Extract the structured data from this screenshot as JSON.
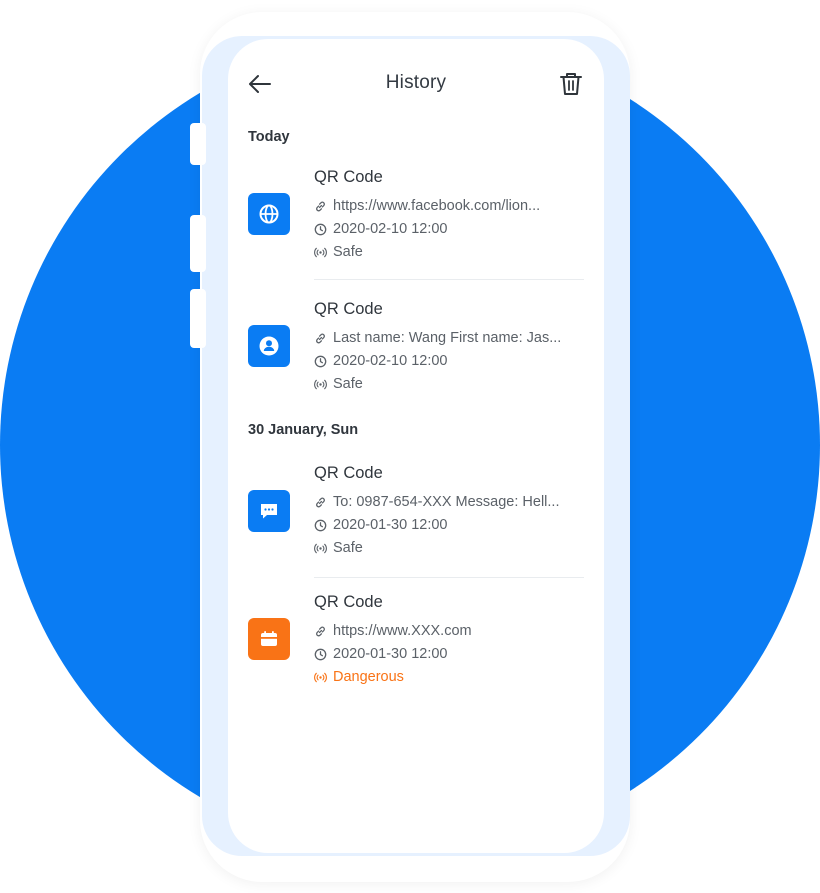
{
  "header": {
    "title": "History"
  },
  "icons": {
    "back": "arrow-left-icon",
    "trash": "trash-icon",
    "link": "link-icon",
    "clock": "clock-icon",
    "status": "signal-icon"
  },
  "colors": {
    "accent": "#0a7cf3",
    "danger": "#f97316"
  },
  "sections": [
    {
      "heading": "Today",
      "items": [
        {
          "title": "QR Code",
          "content": "https://www.facebook.com/lion...",
          "time": "2020-02-10 12:00",
          "status": "Safe",
          "icon": "globe-icon"
        },
        {
          "title": "QR Code",
          "content": "Last name: Wang First name: Jas...",
          "time": "2020-02-10 12:00",
          "status": "Safe",
          "icon": "contact-icon"
        }
      ]
    },
    {
      "heading": "30 January, Sun",
      "items": [
        {
          "title": "QR Code",
          "content": "To: 0987-654-XXX Message: Hell...",
          "time": "2020-01-30 12:00",
          "status": "Safe",
          "icon": "message-icon"
        },
        {
          "title": "QR Code",
          "content": "https://www.XXX.com",
          "time": "2020-01-30 12:00",
          "status": "Dangerous",
          "icon": "calendar-icon"
        }
      ]
    }
  ]
}
